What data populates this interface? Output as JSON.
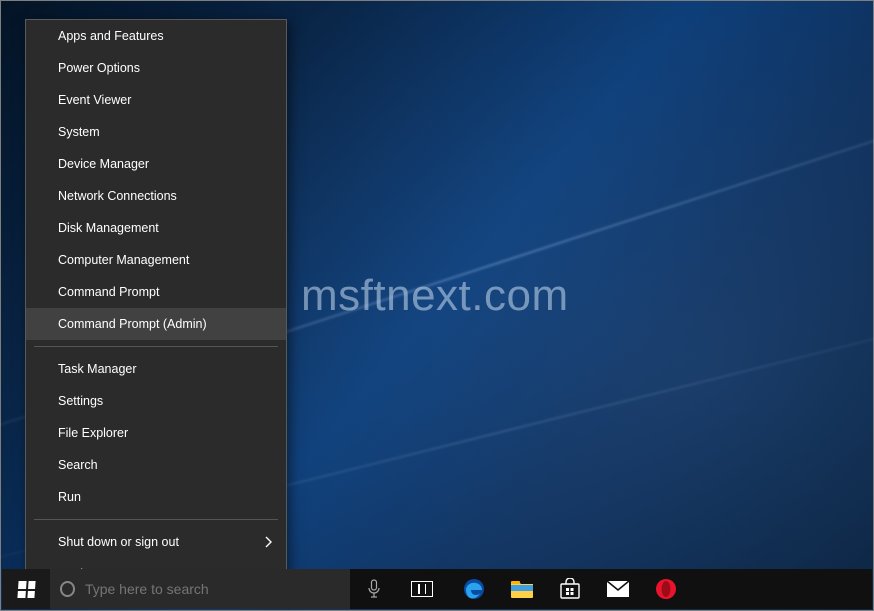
{
  "watermark": "msftnext.com",
  "menu": {
    "items": [
      {
        "label": "Apps and Features"
      },
      {
        "label": "Power Options"
      },
      {
        "label": "Event Viewer"
      },
      {
        "label": "System"
      },
      {
        "label": "Device Manager"
      },
      {
        "label": "Network Connections"
      },
      {
        "label": "Disk Management"
      },
      {
        "label": "Computer Management"
      },
      {
        "label": "Command Prompt"
      },
      {
        "label": "Command Prompt (Admin)"
      }
    ],
    "items2": [
      {
        "label": "Task Manager"
      },
      {
        "label": "Settings"
      },
      {
        "label": "File Explorer"
      },
      {
        "label": "Search"
      },
      {
        "label": "Run"
      }
    ],
    "items3": [
      {
        "label": "Shut down or sign out"
      },
      {
        "label": "Desktop"
      }
    ],
    "highlighted": "Command Prompt (Admin)"
  },
  "taskbar": {
    "search_placeholder": "Type here to search"
  }
}
